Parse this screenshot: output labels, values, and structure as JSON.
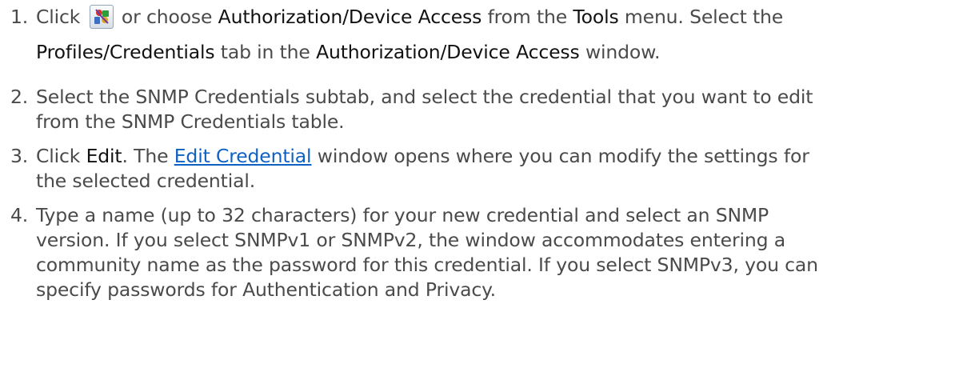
{
  "steps": [
    {
      "number": "1.",
      "lines": [
        {
          "pre": "Click",
          "icon": "authorization-device-access-icon",
          "t1": "or choose",
          "b1": "Authorization/Device Access",
          "t2": "from the",
          "b2": "Tools",
          "t3": "menu. Select the"
        },
        {
          "b1": "Profiles/Credentials",
          "t1": "tab in the",
          "b2": "Authorization/Device Access",
          "t2": "window."
        }
      ]
    },
    {
      "number": "2.",
      "lines": [
        "Select the SNMP Credentials subtab, and select the credential that you want to edit",
        "from the SNMP Credentials table."
      ]
    },
    {
      "number": "3.",
      "lines": [
        {
          "pre": "Click",
          "b1": "Edit",
          "t1": ". The",
          "link": "Edit Credential",
          "t2": "window opens where you can modify the settings for"
        },
        "the selected credential."
      ]
    },
    {
      "number": "4.",
      "lines": [
        "Type a name (up to 32 characters) for your new credential and select an SNMP",
        "version. If you select SNMPv1 or SNMPv2, the window accommodates entering a",
        "community name as the password for this credential. If you select SNMPv3, you can",
        "specify passwords for Authentication and Privacy."
      ]
    }
  ],
  "colors": {
    "text": "#4a4a4a",
    "bold_text": "#111111",
    "link": "#0e61c3"
  }
}
